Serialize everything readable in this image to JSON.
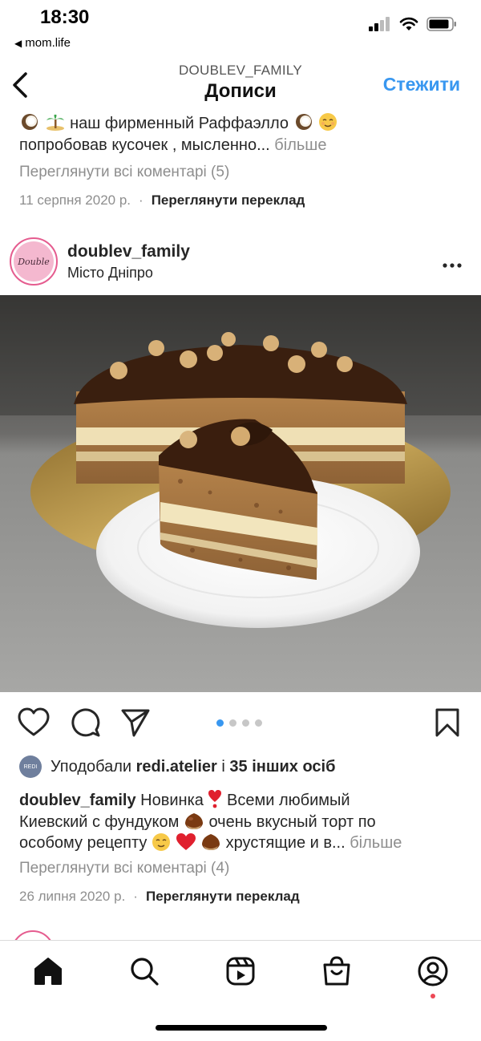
{
  "status_bar": {
    "time": "18:30",
    "back_app": "mom.life"
  },
  "header": {
    "username": "DOUBLEV_FAMILY",
    "title": "Дописи",
    "follow_label": "Стежити"
  },
  "prev_post": {
    "caption_line1": "наш фирменный Раффаэлло",
    "caption_line2": "попробовав кусочек , мысленно...",
    "more_label": "більше",
    "view_comments": "Переглянути всі коментарі (5)",
    "date": "11 серпня 2020 р.",
    "separator": "·",
    "translate_label": "Переглянути переклад"
  },
  "post": {
    "avatar_text": "Double",
    "username": "doublev_family",
    "location": "Місто Дніпро",
    "carousel": {
      "count": 4,
      "active": 1
    },
    "likes": {
      "avatar_text": "REDI",
      "prefix": "Уподобали",
      "liker": "redi.atelier",
      "connector": "і",
      "others": "35 інших осіб"
    },
    "caption": {
      "username": "doublev_family",
      "part1": "Новинка",
      "part2": "Всеми любимый",
      "part3": "Киевский с фундуком",
      "part4": "очень вкусный торт по",
      "part5": "особому рецепту",
      "part6": "хрустящие и в...",
      "more_label": "більше"
    },
    "view_comments": "Переглянути всі коментарі (4)",
    "date": "26 липня 2020 р.",
    "separator": "·",
    "translate_label": "Переглянути переклад"
  },
  "tabbar": {
    "items": [
      "home-icon",
      "search-icon",
      "reels-icon",
      "shop-icon",
      "profile-icon"
    ],
    "notification_color": "#ed4956"
  },
  "colors": {
    "accent": "#3897f0",
    "text": "#262626",
    "muted": "#8e8e8e",
    "story_ring": "#e55c8f"
  }
}
